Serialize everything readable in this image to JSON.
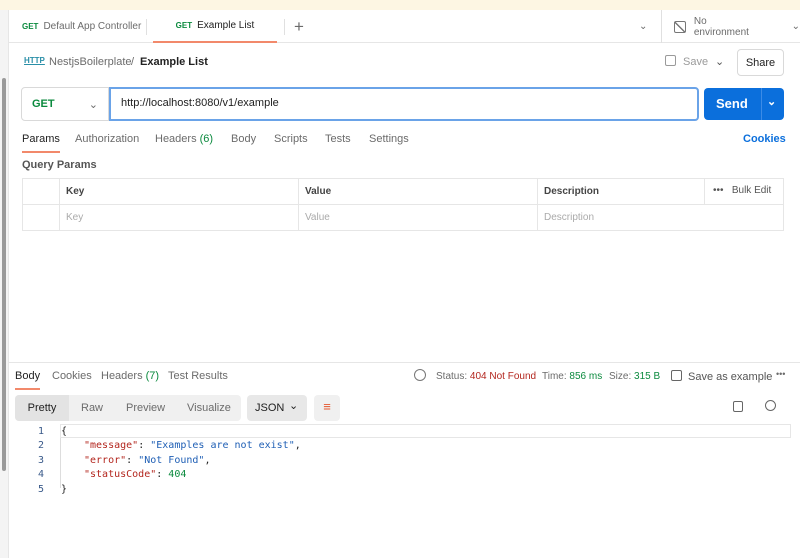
{
  "tabs": [
    {
      "method": "GET",
      "label": "Default App Controller"
    },
    {
      "method": "GET",
      "label": "Example List"
    }
  ],
  "environment": "No environment",
  "breadcrumb": {
    "collection": "NestjsBoilerplate",
    "separator": "/",
    "request": "Example List",
    "icon": "HTTP"
  },
  "actions": {
    "save": "Save",
    "share": "Share"
  },
  "request": {
    "method": "GET",
    "url": "http://localhost:8080/v1/example",
    "send": "Send"
  },
  "req_tabs": {
    "params": "Params",
    "authorization": "Authorization",
    "headers": "Headers",
    "headers_count": "(6)",
    "body": "Body",
    "scripts": "Scripts",
    "tests": "Tests",
    "settings": "Settings",
    "cookies": "Cookies"
  },
  "query_params": {
    "title": "Query Params",
    "headers": [
      "Key",
      "Value",
      "Description"
    ],
    "bulk_edit": "Bulk Edit",
    "placeholders": [
      "Key",
      "Value",
      "Description"
    ]
  },
  "response": {
    "tabs": {
      "body": "Body",
      "cookies": "Cookies",
      "headers": "Headers",
      "headers_count": "(7)",
      "test_results": "Test Results"
    },
    "status_label": "Status:",
    "status": "404 Not Found",
    "time_label": "Time:",
    "time": "856 ms",
    "size_label": "Size:",
    "size": "315 B",
    "save_example": "Save as example",
    "views": [
      "Pretty",
      "Raw",
      "Preview",
      "Visualize"
    ],
    "format": "JSON",
    "lines": [
      "1",
      "2",
      "3",
      "4",
      "5"
    ],
    "code": {
      "open": "{",
      "k1": "\"message\"",
      "v1": "\"Examples are not exist\"",
      "k2": "\"error\"",
      "v2": "\"Not Found\"",
      "k3": "\"statusCode\"",
      "v3": "404",
      "close": "}"
    }
  }
}
